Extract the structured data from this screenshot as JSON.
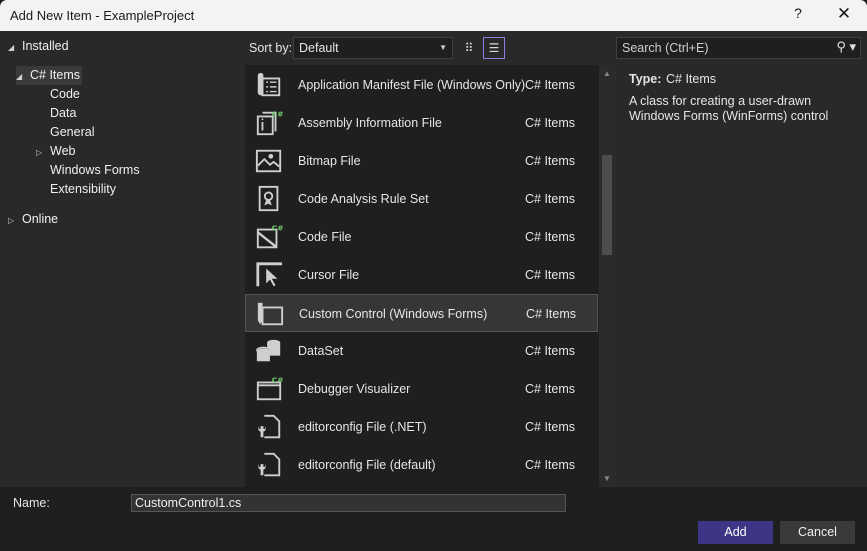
{
  "window": {
    "title": "Add New Item - ExampleProject",
    "help_label": "?",
    "close_label": "✕"
  },
  "tree": {
    "installed": "Installed",
    "csharp_items": "C# Items",
    "children": [
      "Code",
      "Data",
      "General",
      "Web",
      "Windows Forms",
      "Extensibility"
    ],
    "online": "Online",
    "expanded_glyph": "◢",
    "collapsed_glyph": "▷"
  },
  "toolbar": {
    "sort_label": "Sort by:",
    "sort_value": "Default",
    "caret": "▼",
    "grid_view_glyph": "⠿",
    "list_view_glyph": "☰",
    "search_placeholder": "Search (Ctrl+E)",
    "search_icon": "⚲ ▾"
  },
  "items": [
    {
      "name": "Application Manifest File (Windows Only)",
      "type": "C# Items",
      "icon": "manifest-icon"
    },
    {
      "name": "Assembly Information File",
      "type": "C# Items",
      "icon": "assembly-info-icon"
    },
    {
      "name": "Bitmap File",
      "type": "C# Items",
      "icon": "bitmap-icon"
    },
    {
      "name": "Code Analysis Rule Set",
      "type": "C# Items",
      "icon": "ruleset-icon"
    },
    {
      "name": "Code File",
      "type": "C# Items",
      "icon": "code-file-icon"
    },
    {
      "name": "Cursor File",
      "type": "C# Items",
      "icon": "cursor-icon"
    },
    {
      "name": "Custom Control (Windows Forms)",
      "type": "C# Items",
      "icon": "custom-control-icon"
    },
    {
      "name": "DataSet",
      "type": "C# Items",
      "icon": "dataset-icon"
    },
    {
      "name": "Debugger Visualizer",
      "type": "C# Items",
      "icon": "debugger-visualizer-icon"
    },
    {
      "name": "editorconfig File (.NET)",
      "type": "C# Items",
      "icon": "editorconfig-icon"
    },
    {
      "name": "editorconfig File (default)",
      "type": "C# Items",
      "icon": "editorconfig-icon"
    }
  ],
  "selected_index": 6,
  "details": {
    "type_label": "Type:",
    "type_value": "C# Items",
    "description": "A class for creating a user-drawn Windows Forms (WinForms) control"
  },
  "bottom": {
    "name_label": "Name:",
    "name_value": "CustomControl1.cs",
    "add_label": "Add",
    "cancel_label": "Cancel"
  },
  "colors": {
    "accent": "#3e3586",
    "csharp_badge": "#6fcf6f"
  }
}
